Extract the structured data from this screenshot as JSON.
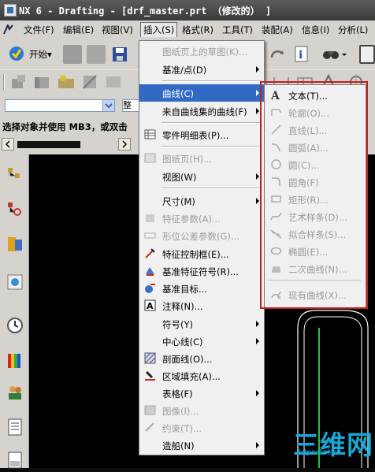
{
  "window": {
    "title": "NX 6 - Drafting - [drf_master.prt （修改的） ]"
  },
  "menubar": {
    "items": [
      "文件(F)",
      "编辑(E)",
      "视图(V)",
      "插入(S)",
      "格式(R)",
      "工具(T)",
      "装配(A)",
      "信息(I)",
      "分析(L)"
    ],
    "active": "插入(S)"
  },
  "toolbar": {
    "start_label": "开始▾"
  },
  "selection": {
    "type_filter_value": "",
    "scope_label": "整"
  },
  "status": {
    "prompt": "选择对象并使用 MB3，或双击"
  },
  "insert_menu": {
    "items": [
      {
        "label": "图纸页上的草图(K)...",
        "disabled": true
      },
      {
        "label": "基准/点(D)",
        "submenu": true
      },
      {
        "label": "曲线(C)",
        "submenu": true,
        "highlighted": true
      },
      {
        "label": "来自曲线集的曲线(F)",
        "submenu": true
      },
      {
        "label": "零件明细表(P)..."
      },
      {
        "label": "图纸页(H)...",
        "disabled": true
      },
      {
        "label": "视图(W)",
        "submenu": true
      },
      {
        "label": "尺寸(M)",
        "submenu": true
      },
      {
        "label": "特征参数(A)...",
        "disabled": true
      },
      {
        "label": "形位公差参数(G)...",
        "disabled": true
      },
      {
        "label": "特征控制框(E)..."
      },
      {
        "label": "基准特征符号(R)..."
      },
      {
        "label": "基准目标..."
      },
      {
        "label": "注释(N)..."
      },
      {
        "label": "符号(Y)",
        "submenu": true
      },
      {
        "label": "中心线(C)",
        "submenu": true
      },
      {
        "label": "剖面线(O)..."
      },
      {
        "label": "区域填充(A)..."
      },
      {
        "label": "表格(F)",
        "submenu": true
      },
      {
        "label": "图像(I)...",
        "disabled": true
      },
      {
        "label": "约束(T)...",
        "disabled": true
      },
      {
        "label": "造船(N)",
        "submenu": true
      }
    ]
  },
  "curve_submenu": {
    "items": [
      {
        "label": "文本(T)...",
        "icon": "text-A-icon"
      },
      {
        "label": "轮廓(O)...",
        "icon": "profile-icon",
        "disabled": true
      },
      {
        "label": "直线(L)...",
        "icon": "line-icon",
        "disabled": true
      },
      {
        "label": "圆弧(A)...",
        "icon": "arc-icon",
        "disabled": true
      },
      {
        "label": "圆(C)...",
        "icon": "circle-icon",
        "disabled": true
      },
      {
        "label": "圆角(F)",
        "icon": "fillet-icon",
        "disabled": true
      },
      {
        "label": "矩形(R)...",
        "icon": "rectangle-icon",
        "disabled": true
      },
      {
        "label": "艺术样条(D)...",
        "icon": "studio-spline-icon",
        "disabled": true
      },
      {
        "label": "拟合样条(S)...",
        "icon": "fit-spline-icon",
        "disabled": true
      },
      {
        "label": "椭圆(E)...",
        "icon": "ellipse-icon",
        "disabled": true
      },
      {
        "label": "二次曲线(N)...",
        "icon": "conic-icon",
        "disabled": true
      },
      {
        "label": "现有曲线(X)...",
        "icon": "existing-curve-icon",
        "disabled": true
      }
    ]
  },
  "watermark": {
    "big": "三维网",
    "small": "3dportal.cn"
  },
  "colors": {
    "highlight": "#316ac5",
    "annotation_box": "#c02020",
    "watermark": "#17a8d8",
    "canvas": "#000000"
  }
}
